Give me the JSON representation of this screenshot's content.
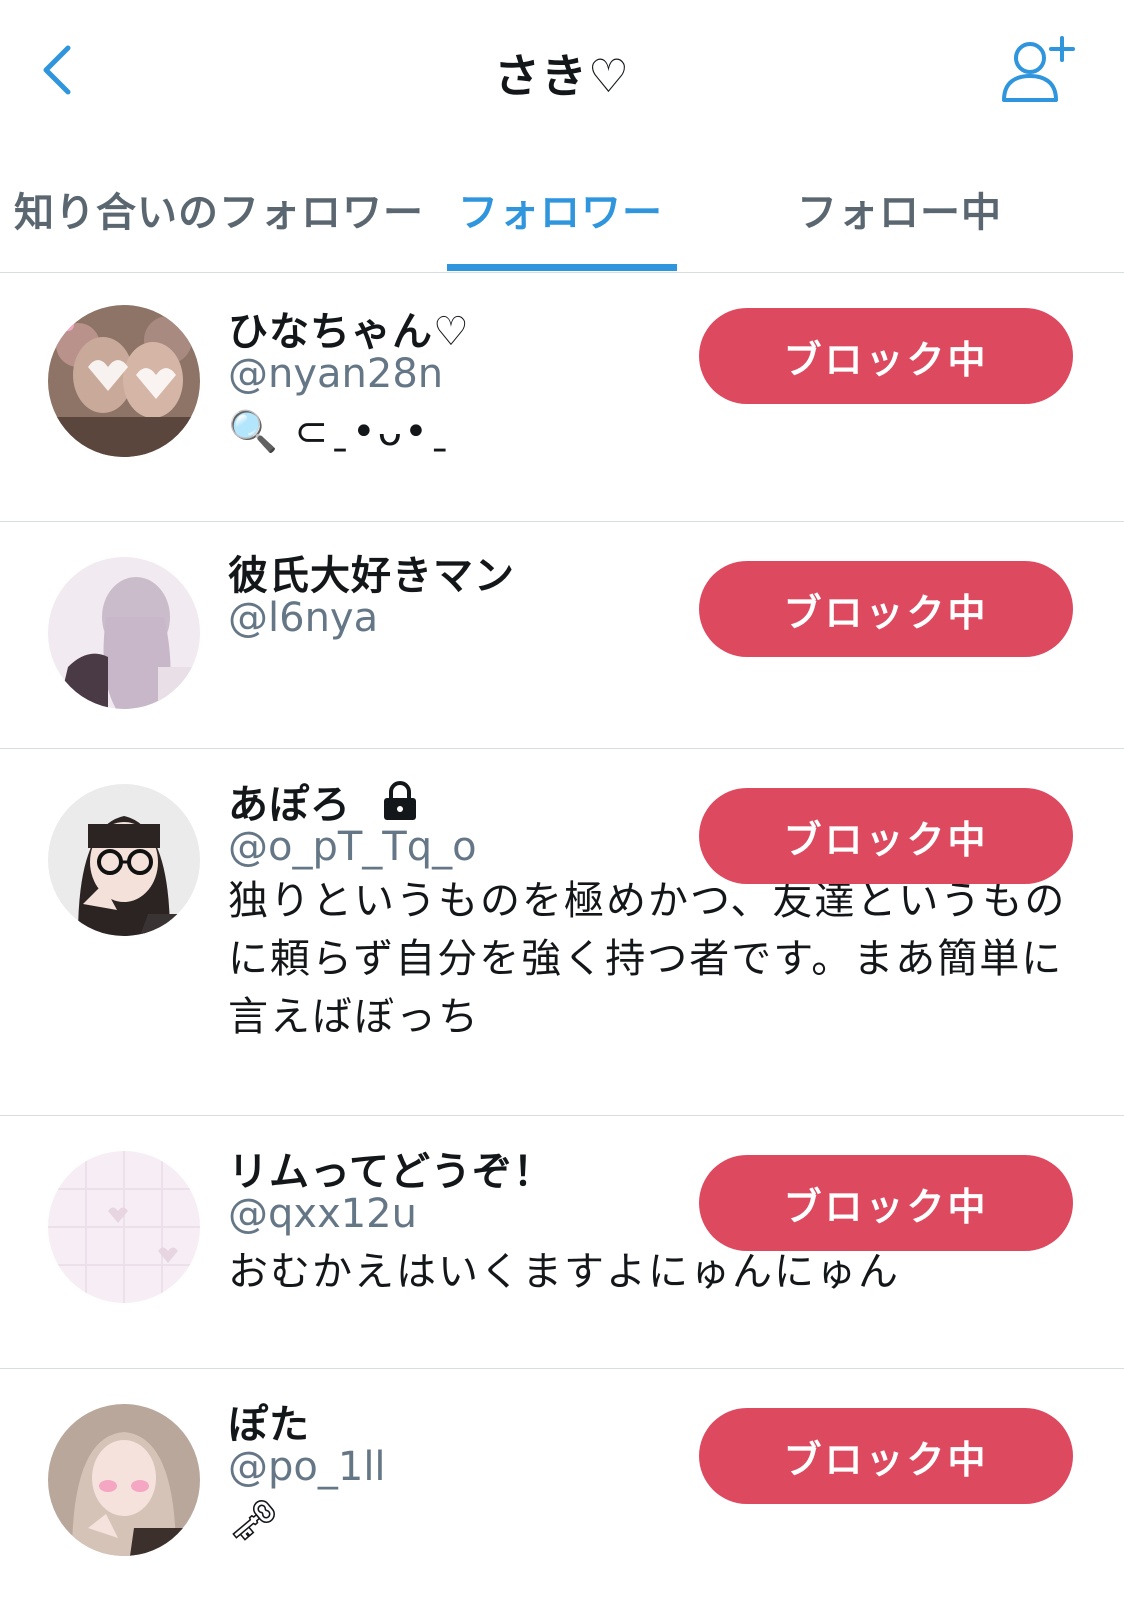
{
  "header": {
    "title": "さき♡",
    "back_icon": "chevron-left-icon",
    "add_icon": "add-user-icon",
    "accent_color": "#2f95dc"
  },
  "tabs": [
    {
      "label": "知り合いのフォロワー",
      "active": false
    },
    {
      "label": "フォロワー",
      "active": true
    },
    {
      "label": "フォロー中",
      "active": false
    }
  ],
  "block_color": "#dd4a60",
  "users": [
    {
      "name": "ひなちゃん♡",
      "handle": "@nyan28n",
      "bio": "🔍 ⊂ˍ•ᴗ•ˍ",
      "locked": false,
      "button": "ブロック中"
    },
    {
      "name": "彼氏大好きマン",
      "handle": "@l6nya",
      "bio": "",
      "locked": false,
      "button": "ブロック中"
    },
    {
      "name": "あぽろ",
      "handle": "@o_pT_Tq_o",
      "bio": "独りというものを極めかつ、友達というものに頼らず自分を強く持つ者です。まあ簡単に言えばぼっち",
      "locked": true,
      "button": "ブロック中"
    },
    {
      "name": "リムってどうぞ！",
      "handle": "@qxx12u",
      "bio": "おむかえはいくますよにゅんにゅん",
      "locked": false,
      "button": "ブロック中"
    },
    {
      "name": "ぽた",
      "handle": "@po_1ll",
      "bio": "🗝",
      "locked": false,
      "button": "ブロック中"
    }
  ]
}
